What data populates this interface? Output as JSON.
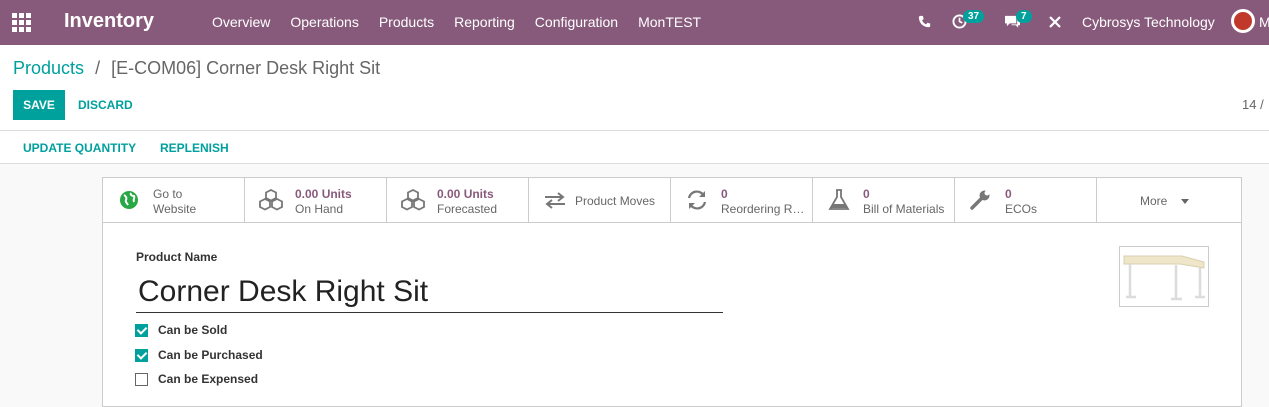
{
  "app": {
    "title": "Inventory",
    "menu": [
      "Overview",
      "Operations",
      "Products",
      "Reporting",
      "Configuration",
      "MonTEST"
    ],
    "activity_count": "37",
    "messages_count": "7",
    "company": "Cybrosys Technology",
    "user_initial": "M",
    "accent": "#875a7b",
    "primary": "#00a09d"
  },
  "breadcrumb": {
    "parent": "Products",
    "separator": "/",
    "current": "[E-COM06] Corner Desk Right Sit"
  },
  "actions": {
    "save": "SAVE",
    "discard": "DISCARD",
    "pager": "14 /"
  },
  "statusbar": {
    "update_quantity": "UPDATE QUANTITY",
    "replenish": "REPLENISH"
  },
  "smart_buttons": [
    {
      "line1": "Go to",
      "line2": "Website",
      "icon": "globe-icon"
    },
    {
      "line1": "0.00 Units",
      "line2": "On Hand",
      "icon": "cubes-icon"
    },
    {
      "line1": "0.00 Units",
      "line2": "Forecasted",
      "icon": "cubes-icon"
    },
    {
      "label": "Product Moves",
      "icon": "exchange-icon"
    },
    {
      "line1": "0",
      "line2": "Reordering Rules",
      "icon": "refresh-icon"
    },
    {
      "line1": "0",
      "line2": "Bill of Materials",
      "icon": "flask-icon"
    },
    {
      "line1": "0",
      "line2": "ECOs",
      "icon": "wrench-icon"
    },
    {
      "label": "More",
      "icon": "caret-down-icon"
    }
  ],
  "form": {
    "name_label": "Product Name",
    "name_value": "Corner Desk Right Sit",
    "checkboxes": [
      {
        "label": "Can be Sold",
        "checked": true
      },
      {
        "label": "Can be Purchased",
        "checked": true
      },
      {
        "label": "Can be Expensed",
        "checked": false
      }
    ]
  }
}
